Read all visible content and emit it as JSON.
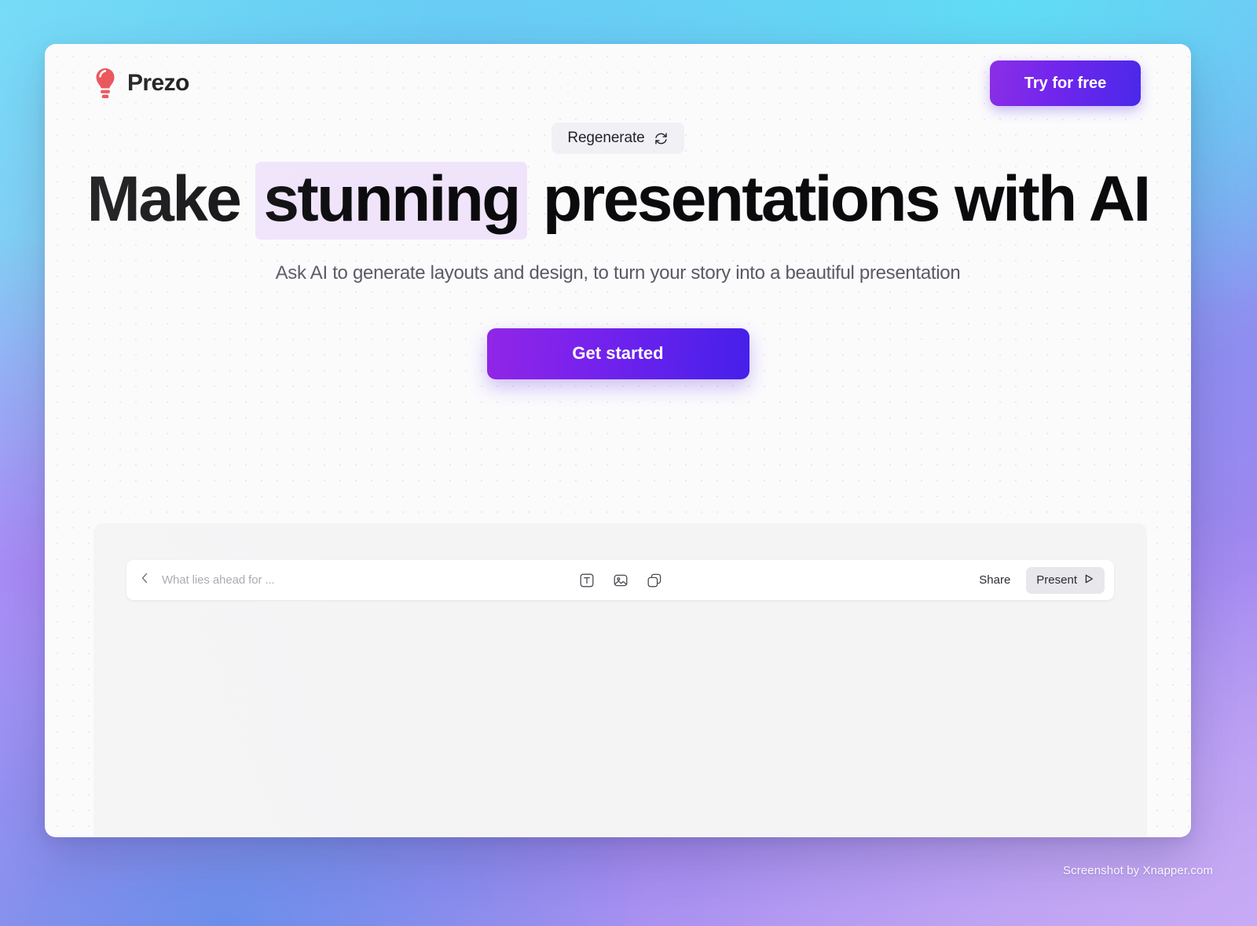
{
  "header": {
    "brand_name": "Prezo",
    "logo_icon": "lightbulb-icon",
    "logo_color": "#e8434a",
    "try_button_label": "Try for free"
  },
  "hero": {
    "regenerate_label": "Regenerate",
    "regenerate_icon": "refresh-cycle-icon",
    "headline_part1": "Make ",
    "headline_highlight": "stunning",
    "headline_part2": " presentations with AI",
    "highlight_color": "#f0e4fb",
    "subtitle": "Ask AI to generate layouts and design, to turn your story into a beautiful presentation",
    "cta_label": "Get started",
    "cta_gradient_from": "#9126e6",
    "cta_gradient_to": "#4520ea"
  },
  "editor": {
    "back_icon": "chevron-left-icon",
    "document_title": "What lies ahead for ...",
    "tools": [
      {
        "name": "text-tool-icon",
        "label": "Text"
      },
      {
        "name": "image-tool-icon",
        "label": "Image"
      },
      {
        "name": "shapes-tool-icon",
        "label": "Shapes"
      }
    ],
    "share_label": "Share",
    "present_label": "Present",
    "present_icon": "play-triangle-icon"
  },
  "watermark": {
    "text": "Screenshot by Xnapper.com"
  },
  "theme": {
    "accent": "#7326ec",
    "bg_top_left": "#5cd6f5",
    "bg_bottom_left": "#5b86e8",
    "bg_mid_left": "#9f86ef",
    "bg_bottom_right": "#bda5f2",
    "card_bg": "#fbfbfc"
  }
}
